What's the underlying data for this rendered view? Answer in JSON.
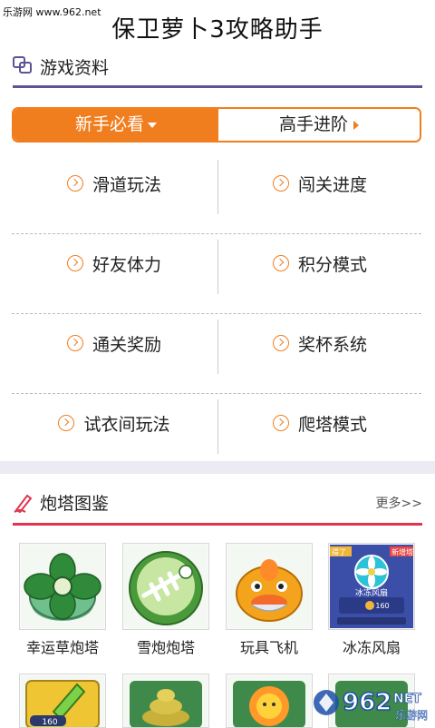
{
  "watermark_top": "乐游网 www.962.net",
  "app_title": "保卫萝卜3攻略助手",
  "section_info": {
    "title": "游戏资料"
  },
  "tabs": {
    "beginner": "新手必看",
    "advanced": "高手进阶"
  },
  "guide_grid": [
    [
      "滑道玩法",
      "闯关进度"
    ],
    [
      "好友体力",
      "积分模式"
    ],
    [
      "通关奖励",
      "奖杯系统"
    ],
    [
      "试衣间玩法",
      "爬塔模式"
    ]
  ],
  "section_towers": {
    "title": "炮塔图鉴",
    "more": "更多>>"
  },
  "towers": [
    {
      "name": "幸运草炮塔",
      "icon": "clover-tower-icon"
    },
    {
      "name": "雪炮炮塔",
      "icon": "snow-tower-icon"
    },
    {
      "name": "玩具飞机",
      "icon": "toy-plane-icon"
    },
    {
      "name": "冰冻风扇",
      "icon": "ice-fan-icon"
    }
  ],
  "fan_card": {
    "tag_left": "得了",
    "tag_right": "新增塔",
    "title": "冰冻风扇",
    "cost": "160"
  },
  "partial_card_cost": "160",
  "watermark_logo": {
    "big": "962",
    "net": "NET",
    "cn": "乐游网"
  },
  "colors": {
    "accent_orange": "#f07e1f",
    "section1_line": "#5d5496",
    "section2_line": "#e0344e"
  }
}
